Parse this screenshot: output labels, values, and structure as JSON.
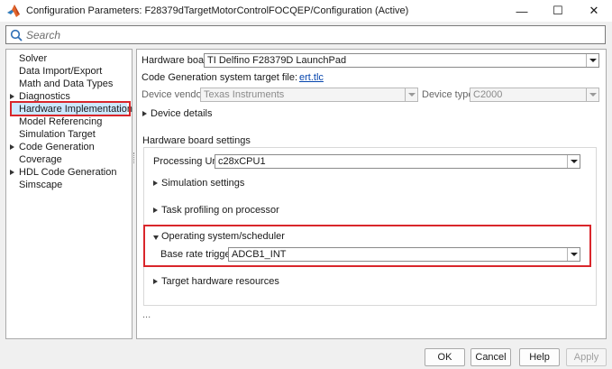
{
  "window": {
    "title": "Configuration Parameters: F28379dTargetMotorControlFOCQEP/Configuration (Active)",
    "minimize_glyph": "—",
    "maximize_glyph": "☐",
    "close_glyph": "✕"
  },
  "search": {
    "placeholder": "Search",
    "value": ""
  },
  "tree": {
    "items": [
      {
        "label": "Solver",
        "expandable": false,
        "selected": false
      },
      {
        "label": "Data Import/Export",
        "expandable": false,
        "selected": false
      },
      {
        "label": "Math and Data Types",
        "expandable": false,
        "selected": false
      },
      {
        "label": "Diagnostics",
        "expandable": true,
        "selected": false
      },
      {
        "label": "Hardware Implementation",
        "expandable": false,
        "selected": true
      },
      {
        "label": "Model Referencing",
        "expandable": false,
        "selected": false
      },
      {
        "label": "Simulation Target",
        "expandable": false,
        "selected": false
      },
      {
        "label": "Code Generation",
        "expandable": true,
        "selected": false
      },
      {
        "label": "Coverage",
        "expandable": false,
        "selected": false
      },
      {
        "label": "HDL Code Generation",
        "expandable": true,
        "selected": false
      },
      {
        "label": "Simscape",
        "expandable": false,
        "selected": false
      }
    ]
  },
  "panel": {
    "hardware_board_label": "Hardware board:",
    "hardware_board_value": "TI Delfino F28379D LaunchPad",
    "codegen_target_label": "Code Generation system target file:",
    "codegen_target_link": "ert.tlc",
    "device_vendor_label": "Device vendor:",
    "device_vendor_value": "Texas Instruments",
    "device_type_label": "Device type:",
    "device_type_value": "C2000",
    "device_details_label": "Device details",
    "board_settings_heading": "Hardware board settings",
    "processing_unit_label": "Processing Unit:",
    "processing_unit_value": "c28xCPU1",
    "simulation_settings_label": "Simulation settings",
    "task_profiling_label": "Task profiling on processor",
    "os_scheduler_label": "Operating system/scheduler",
    "base_rate_label": "Base rate trigger:",
    "base_rate_value": "ADCB1_INT",
    "target_resources_label": "Target hardware resources",
    "ellipsis": "..."
  },
  "footer": {
    "ok": "OK",
    "cancel": "Cancel",
    "help": "Help",
    "apply": "Apply"
  },
  "colors": {
    "selection_bg": "#cde8ff",
    "highlight_border": "#d9262b",
    "link": "#0645ad",
    "matlab_logo": "#e1642b"
  }
}
